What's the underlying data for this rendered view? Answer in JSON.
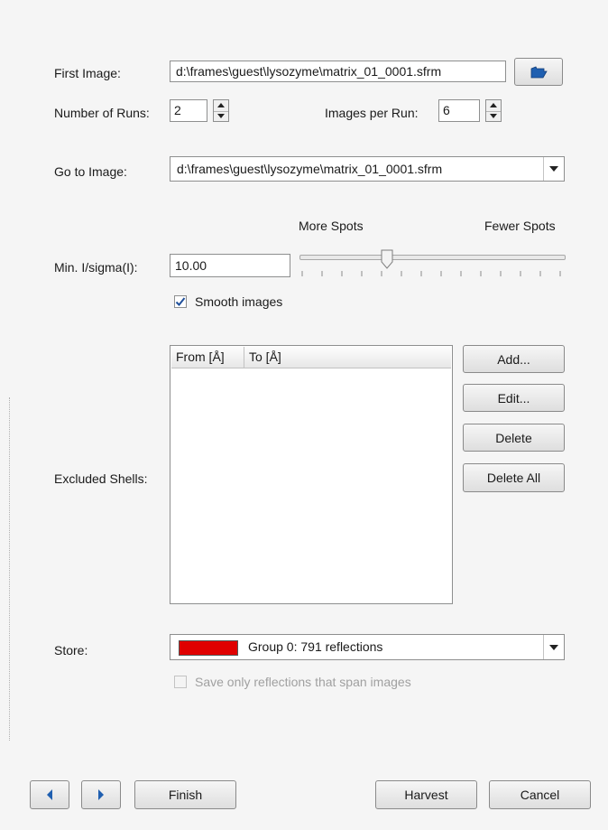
{
  "first_image": {
    "label": "First Image:",
    "value": "d:\\frames\\guest\\lysozyme\\matrix_01_0001.sfrm",
    "browse_icon": "folder-open-icon"
  },
  "runs": {
    "label": "Number of Runs:",
    "value": "2",
    "images_label": "Images per Run:",
    "images_value": "6"
  },
  "goto_image": {
    "label": "Go to Image:",
    "value": "d:\\frames\\guest\\lysozyme\\matrix_01_0001.sfrm"
  },
  "threshold": {
    "label": "Min. I/sigma(I):",
    "value": "10.00",
    "more_label": "More Spots",
    "fewer_label": "Fewer Spots",
    "slider_position_fraction": 0.33
  },
  "smooth": {
    "label": "Smooth images",
    "checked": true
  },
  "excluded_shells": {
    "label": "Excluded Shells:",
    "columns": [
      "From [Å]",
      "To [Å]"
    ],
    "rows": [],
    "buttons": {
      "add": "Add...",
      "edit": "Edit...",
      "delete": "Delete",
      "delete_all": "Delete All"
    }
  },
  "store": {
    "label": "Store:",
    "value": "Group 0: 791 reflections",
    "swatch_color": "#e00000"
  },
  "save_span": {
    "label": "Save only reflections that span images",
    "checked": false,
    "enabled": false
  },
  "footer": {
    "prev_icon": "arrow-left-icon",
    "next_icon": "arrow-right-icon",
    "finish": "Finish",
    "harvest": "Harvest",
    "cancel": "Cancel"
  },
  "colors": {
    "accent_blue": "#1f5fb0"
  }
}
